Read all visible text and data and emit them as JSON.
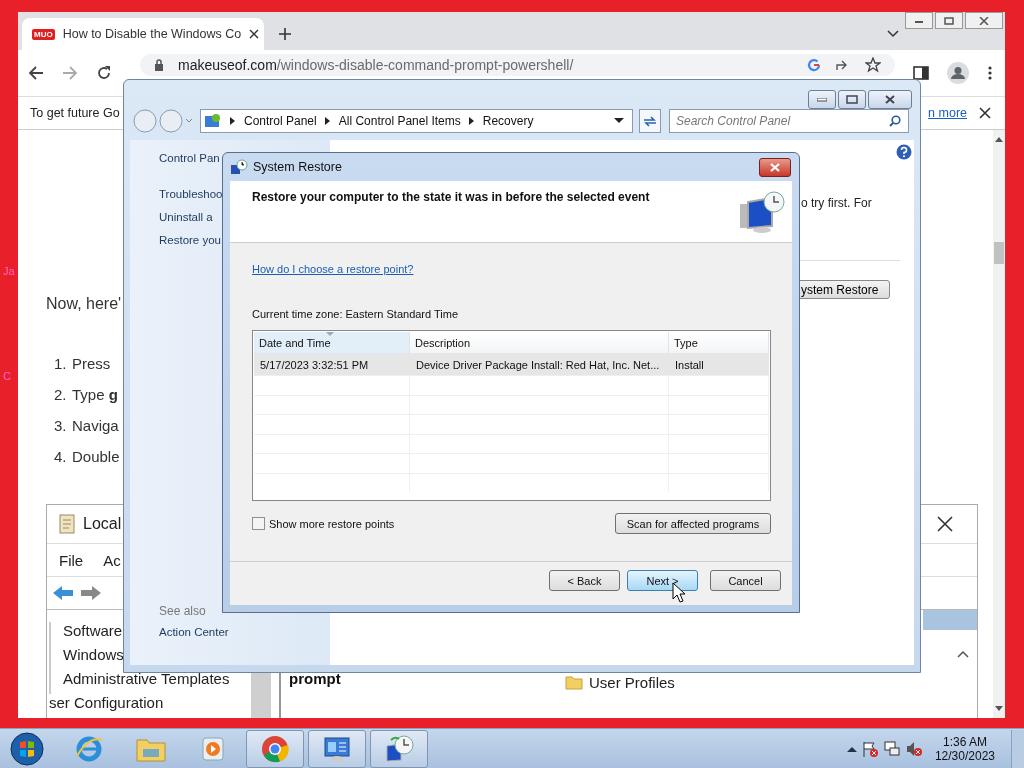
{
  "desktop_labels": [
    "Ja",
    "C"
  ],
  "browser": {
    "tab": {
      "favicon": "MUO",
      "title": "How to Disable the Windows Co",
      "selected": true
    },
    "url": {
      "domain": "makeuseof.com",
      "path": "/windows-disable-command-prompt-powershell/"
    },
    "infobar": {
      "text": "To get future Go",
      "link": "n more"
    },
    "page": {
      "intro": "Now, here'",
      "steps": [
        {
          "number": "1.",
          "text": "Press"
        },
        {
          "number": "2.",
          "text": "Type **g**"
        },
        {
          "number": "3.",
          "text": "Naviga"
        },
        {
          "number": "4.",
          "text": "Double"
        }
      ],
      "figure": {
        "title": "Local",
        "menu": [
          "File",
          "Ac"
        ],
        "tree": [
          "Software",
          "Windows",
          "Administrative Templates",
          "ser Configuration"
        ],
        "heading": "prompt",
        "folder": "User Profiles"
      }
    }
  },
  "control_panel": {
    "breadcrumb": [
      "Control Panel",
      "All Control Panel Items",
      "Recovery"
    ],
    "search": {
      "placeholder": "Search Control Panel"
    },
    "sidebar": {
      "title": "Control Pan",
      "links": [
        "Troubleshoo",
        "Uninstall a",
        "Restore you"
      ],
      "see_also": "See also",
      "see_also_links": [
        "Action Center"
      ]
    },
    "content": {
      "text": "o try first. For",
      "button": "ystem Restore"
    }
  },
  "dialog": {
    "title": "System Restore",
    "heading": "Restore your computer to the state it was in before the selected event",
    "help_link": "How do I choose a restore point?",
    "timezone": "Current time zone: Eastern Standard Time",
    "table": {
      "columns": [
        {
          "label": "Date and Time",
          "sorted": true
        },
        {
          "label": "Description",
          "sorted": false
        },
        {
          "label": "Type",
          "sorted": false
        }
      ],
      "rows": [
        {
          "cells": [
            "5/17/2023 3:32:51 PM",
            "Device Driver Package Install: Red Hat, Inc. Net...",
            "Install"
          ],
          "selected": true
        }
      ]
    },
    "show_more": {
      "label": "Show more restore points",
      "checked": false
    },
    "scan_button": "Scan for affected programs",
    "buttons": [
      {
        "label": "< Back",
        "default": false
      },
      {
        "label": "Next >",
        "default": true
      },
      {
        "label": "Cancel",
        "default": false
      }
    ]
  },
  "taskbar": {
    "apps": [
      {
        "kind": "ie",
        "open": false
      },
      {
        "kind": "explorer",
        "open": false
      },
      {
        "kind": "media",
        "open": false
      },
      {
        "kind": "chrome",
        "open": true
      },
      {
        "kind": "control",
        "open": true
      },
      {
        "kind": "restore",
        "open": true
      }
    ],
    "clock": {
      "time": "1:36 AM",
      "date": "12/30/2023"
    }
  }
}
